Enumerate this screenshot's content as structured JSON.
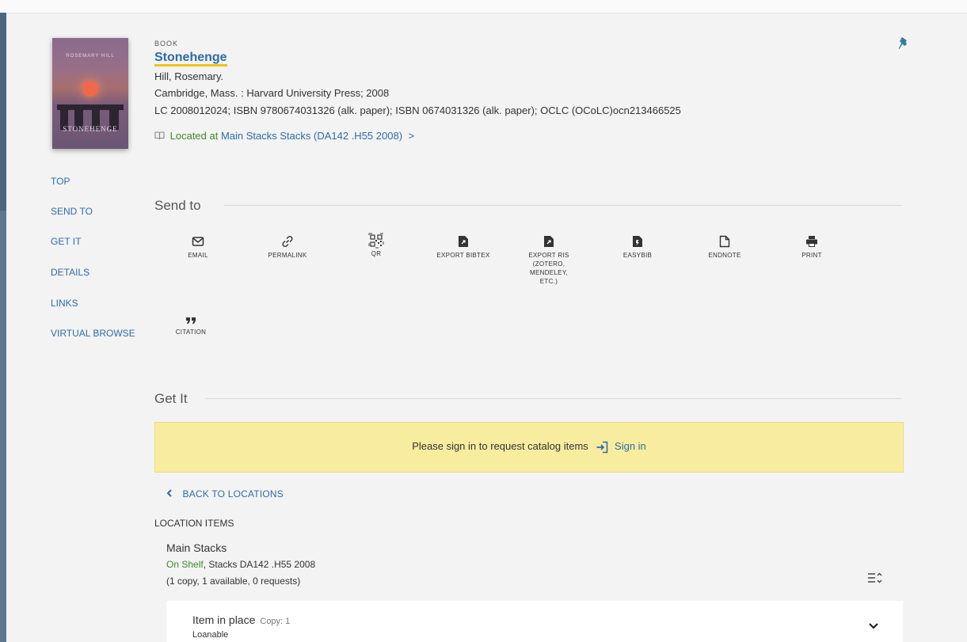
{
  "record": {
    "type": "BOOK",
    "title": "Stonehenge",
    "author": "Hill, Rosemary.",
    "publication": "Cambridge, Mass. : Harvard University Press; 2008",
    "identifiers": "LC 2008012024; ISBN 9780674031326 (alk. paper); ISBN 0674031326 (alk. paper); OCLC (OCoLC)ocn213466525",
    "location_prefix": "Located at",
    "location_link": "Main Stacks  Stacks (DA142 .H55 2008)",
    "location_arrow": ">",
    "cover": {
      "author_text": "ROSEMARY HILL",
      "title_text": "STONEHENGE"
    }
  },
  "nav": {
    "items": [
      "TOP",
      "SEND TO",
      "GET IT",
      "DETAILS",
      "LINKS",
      "VIRTUAL BROWSE"
    ]
  },
  "send_to": {
    "heading": "Send to",
    "actions": [
      {
        "label": "EMAIL",
        "icon": "email-icon"
      },
      {
        "label": "PERMALINK",
        "icon": "link-icon"
      },
      {
        "label": "QR",
        "icon": "qr-icon"
      },
      {
        "label": "EXPORT BIBTEX",
        "icon": "file-export-icon"
      },
      {
        "label": "EXPORT RIS (ZOTERO, MENDELEY, ETC.)",
        "icon": "file-export-icon"
      },
      {
        "label": "EASYBIB",
        "icon": "file-easybib-icon"
      },
      {
        "label": "ENDNOTE",
        "icon": "file-outline-icon"
      },
      {
        "label": "PRINT",
        "icon": "printer-icon"
      },
      {
        "label": "CITATION",
        "icon": "quote-icon"
      }
    ]
  },
  "get_it": {
    "heading": "Get It",
    "signin_message": "Please sign in to request catalog items",
    "signin_link": "Sign in",
    "back_label": "BACK TO LOCATIONS",
    "location_items_label": "LOCATION ITEMS",
    "location": {
      "name": "Main Stacks",
      "status": "On Shelf",
      "shelf": ", Stacks DA142 .H55 2008",
      "counts": "(1 copy, 1 available, 0 requests)"
    },
    "item": {
      "title": "Item in place",
      "copy": "Copy: 1",
      "policy": "Loanable"
    }
  },
  "colors": {
    "link": "#2d6ca8",
    "available": "#3f8a2a",
    "signin_bg": "#f8ec9f",
    "title_underline": "#f0c31a"
  }
}
